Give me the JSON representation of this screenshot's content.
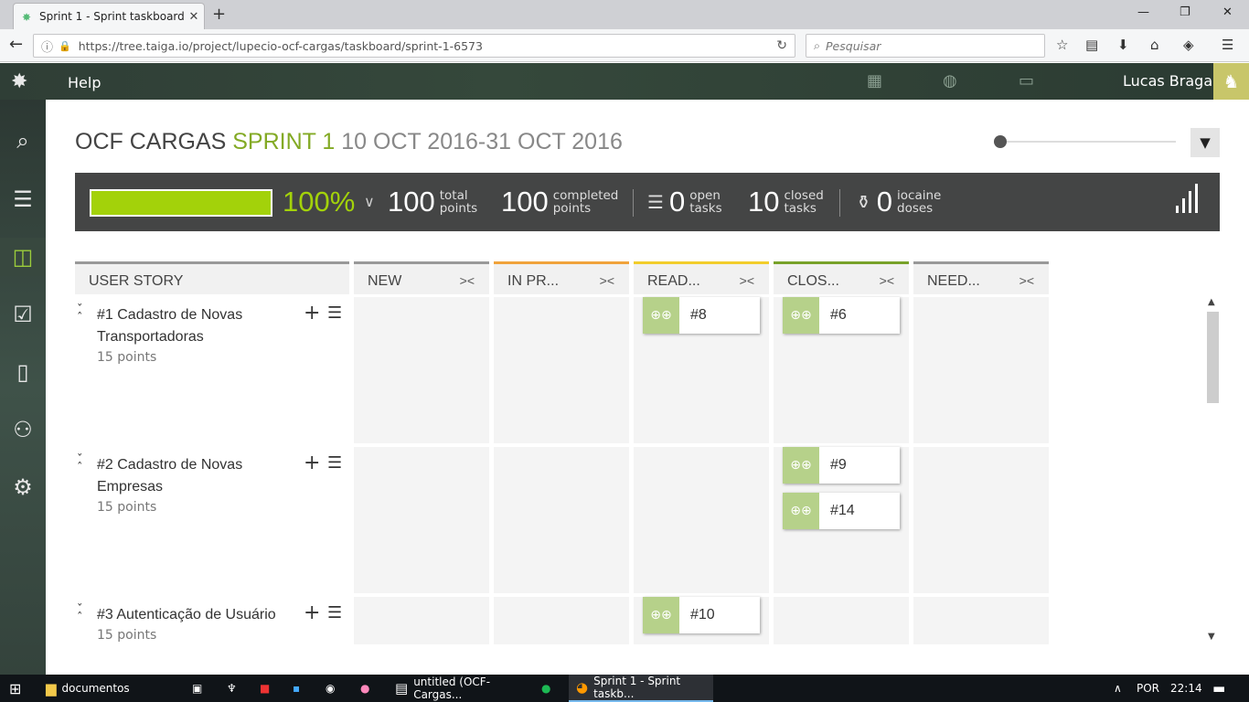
{
  "browser": {
    "tab_title": "Sprint 1 - Sprint taskboard...",
    "url": "https://tree.taiga.io/project/lupecio-ocf-cargas/taskboard/sprint-1-6573",
    "search_placeholder": "Pesquisar"
  },
  "topnav": {
    "help": "Help",
    "user_name": "Lucas Braga"
  },
  "header": {
    "project": "OCF CARGAS",
    "sprint": "SPRINT 1",
    "dates": "10 OCT 2016-31 OCT 2016"
  },
  "summary": {
    "progress_percent": "100%",
    "progress_fraction": 1.0,
    "total_points": "100",
    "total_points_label_1": "total",
    "total_points_label_2": "points",
    "completed_points": "100",
    "completed_points_label_1": "completed",
    "completed_points_label_2": "points",
    "open_tasks": "0",
    "open_tasks_label_1": "open",
    "open_tasks_label_2": "tasks",
    "closed_tasks": "10",
    "closed_tasks_label_1": "closed",
    "closed_tasks_label_2": "tasks",
    "iocaine_doses": "0",
    "iocaine_label_1": "iocaine",
    "iocaine_label_2": "doses"
  },
  "columns": {
    "user_story": "USER STORY",
    "new": "NEW",
    "in_progress": "IN PR...",
    "ready": "READ...",
    "closed": "CLOS...",
    "needs": "NEED..."
  },
  "column_colors": {
    "new": "#999999",
    "in_progress": "#f0a33c",
    "ready": "#f2cd2c",
    "closed": "#78a22a",
    "needs": "#999999"
  },
  "stories": [
    {
      "title": "#1 Cadastro de Novas Transportadoras",
      "points": "15 points"
    },
    {
      "title": "#2 Cadastro de Novas Empresas",
      "points": "15 points"
    },
    {
      "title": "#3 Autenticação de Usuário",
      "points": "15 points"
    }
  ],
  "tasks": {
    "s1_ready": "#8",
    "s1_closed": "#6",
    "s2_closed_a": "#9",
    "s2_closed_b": "#14",
    "s3_ready": "#10"
  },
  "taskbar": {
    "folder": "documentos",
    "app1": "untitled (OCF-Cargas...",
    "app2": "Sprint 1 - Sprint taskb...",
    "lang": "POR",
    "time": "22:14"
  }
}
